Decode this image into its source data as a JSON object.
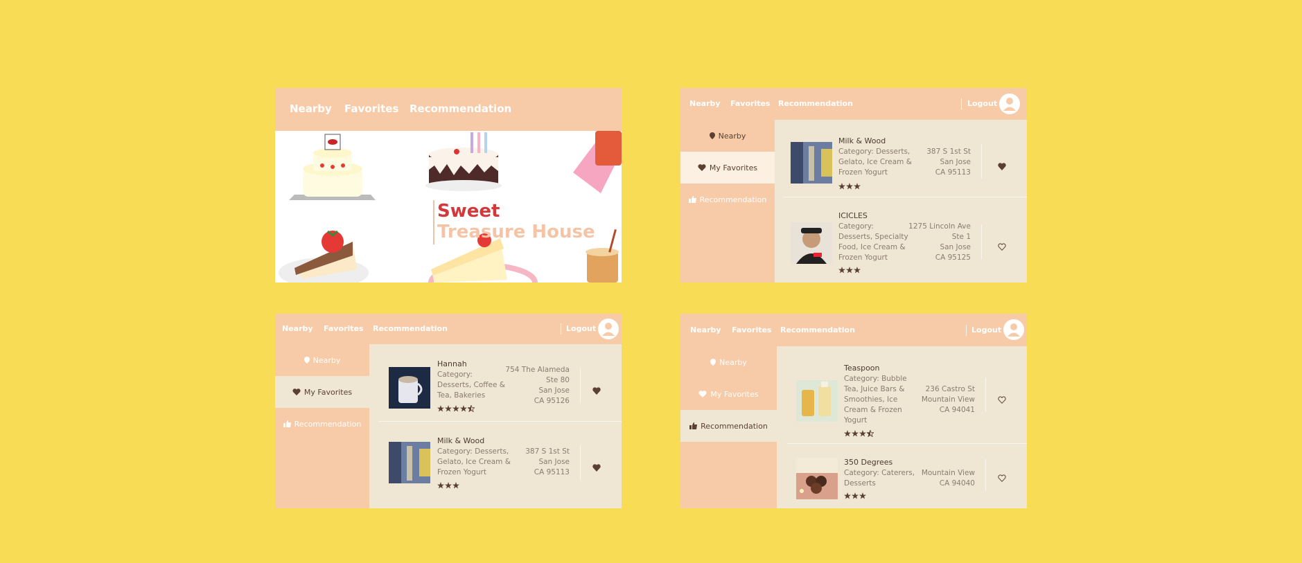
{
  "colors": {
    "background": "#f8dc55",
    "nav": "#f8cba8",
    "content": "#efe7d3",
    "text": "#4a3a2c",
    "accent_red": "#d4383b"
  },
  "screens": [
    {
      "nav": {
        "nearby": "Nearby",
        "favorites": "Favorites",
        "recommendation": "Recommendation"
      },
      "hero": {
        "title_line1": "Sweet",
        "title_line2": "Treasure House"
      }
    },
    {
      "nav": {
        "nearby": "Nearby",
        "favorites": "Favorites",
        "recommendation": "Recommendation",
        "logout": "Logout"
      },
      "sidebar": {
        "nearby": "Nearby",
        "favorites": "My Favorites",
        "recommendation": "Recommendation",
        "active": "favorites"
      },
      "items": [
        {
          "name": "Milk & Wood",
          "category": [
            "Category: Desserts,",
            "Gelato, Ice Cream &",
            "Frozen Yogurt"
          ],
          "address": [
            "387 S 1st St",
            "San Jose",
            "CA 95113"
          ],
          "rating": 3,
          "favorited": true,
          "thumb_icon": "bottle-photo-icon"
        },
        {
          "name": "ICICLES",
          "category": [
            "Category:",
            "Desserts, Specialty",
            "Food, Ice Cream &",
            "Frozen Yogurt"
          ],
          "address": [
            "1275 Lincoln Ave",
            "Ste 1",
            "San Jose",
            "CA 95125"
          ],
          "rating": 3,
          "favorited": false,
          "thumb_icon": "person-photo-icon"
        }
      ]
    },
    {
      "nav": {
        "nearby": "Nearby",
        "favorites": "Favorites",
        "recommendation": "Recommendation",
        "logout": "Logout"
      },
      "sidebar": {
        "nearby": "Nearby",
        "favorites": "My Favorites",
        "recommendation": "Recommendation",
        "active": "favorites"
      },
      "items": [
        {
          "name": "Hannah",
          "category": [
            "Category:",
            "Desserts, Coffee &",
            "Tea, Bakeries"
          ],
          "address": [
            "754 The Alameda",
            "Ste 80",
            "San Jose",
            "CA 95126"
          ],
          "rating": 4.5,
          "favorited": true,
          "thumb_icon": "coffee-cup-photo-icon"
        },
        {
          "name": "Milk & Wood",
          "category": [
            "Category: Desserts,",
            "Gelato, Ice Cream &",
            "Frozen Yogurt"
          ],
          "address": [
            "387 S 1st St",
            "San Jose",
            "CA 95113"
          ],
          "rating": 3,
          "favorited": true,
          "thumb_icon": "bottle-photo-icon"
        }
      ]
    },
    {
      "nav": {
        "nearby": "Nearby",
        "favorites": "Favorites",
        "recommendation": "Recommendation",
        "logout": "Logout"
      },
      "sidebar": {
        "nearby": "Nearby",
        "favorites": "My Favorites",
        "recommendation": "Recommendation",
        "active": "recommendation"
      },
      "items": [
        {
          "name": "Teaspoon",
          "category": [
            "Category: Bubble",
            "Tea, Juice Bars &",
            "Smoothies, Ice",
            "Cream & Frozen",
            "Yogurt"
          ],
          "address": [
            "236 Castro St",
            "Mountain View",
            "CA 94041"
          ],
          "rating": 3.5,
          "favorited": false,
          "thumb_icon": "drinks-photo-icon"
        },
        {
          "name": "350 Degrees",
          "category": [
            "Category: Caterers,",
            "Desserts"
          ],
          "address": [
            "Mountain View",
            "CA 94040"
          ],
          "rating": 3,
          "favorited": false,
          "thumb_icon": "pastries-photo-icon"
        }
      ]
    }
  ]
}
